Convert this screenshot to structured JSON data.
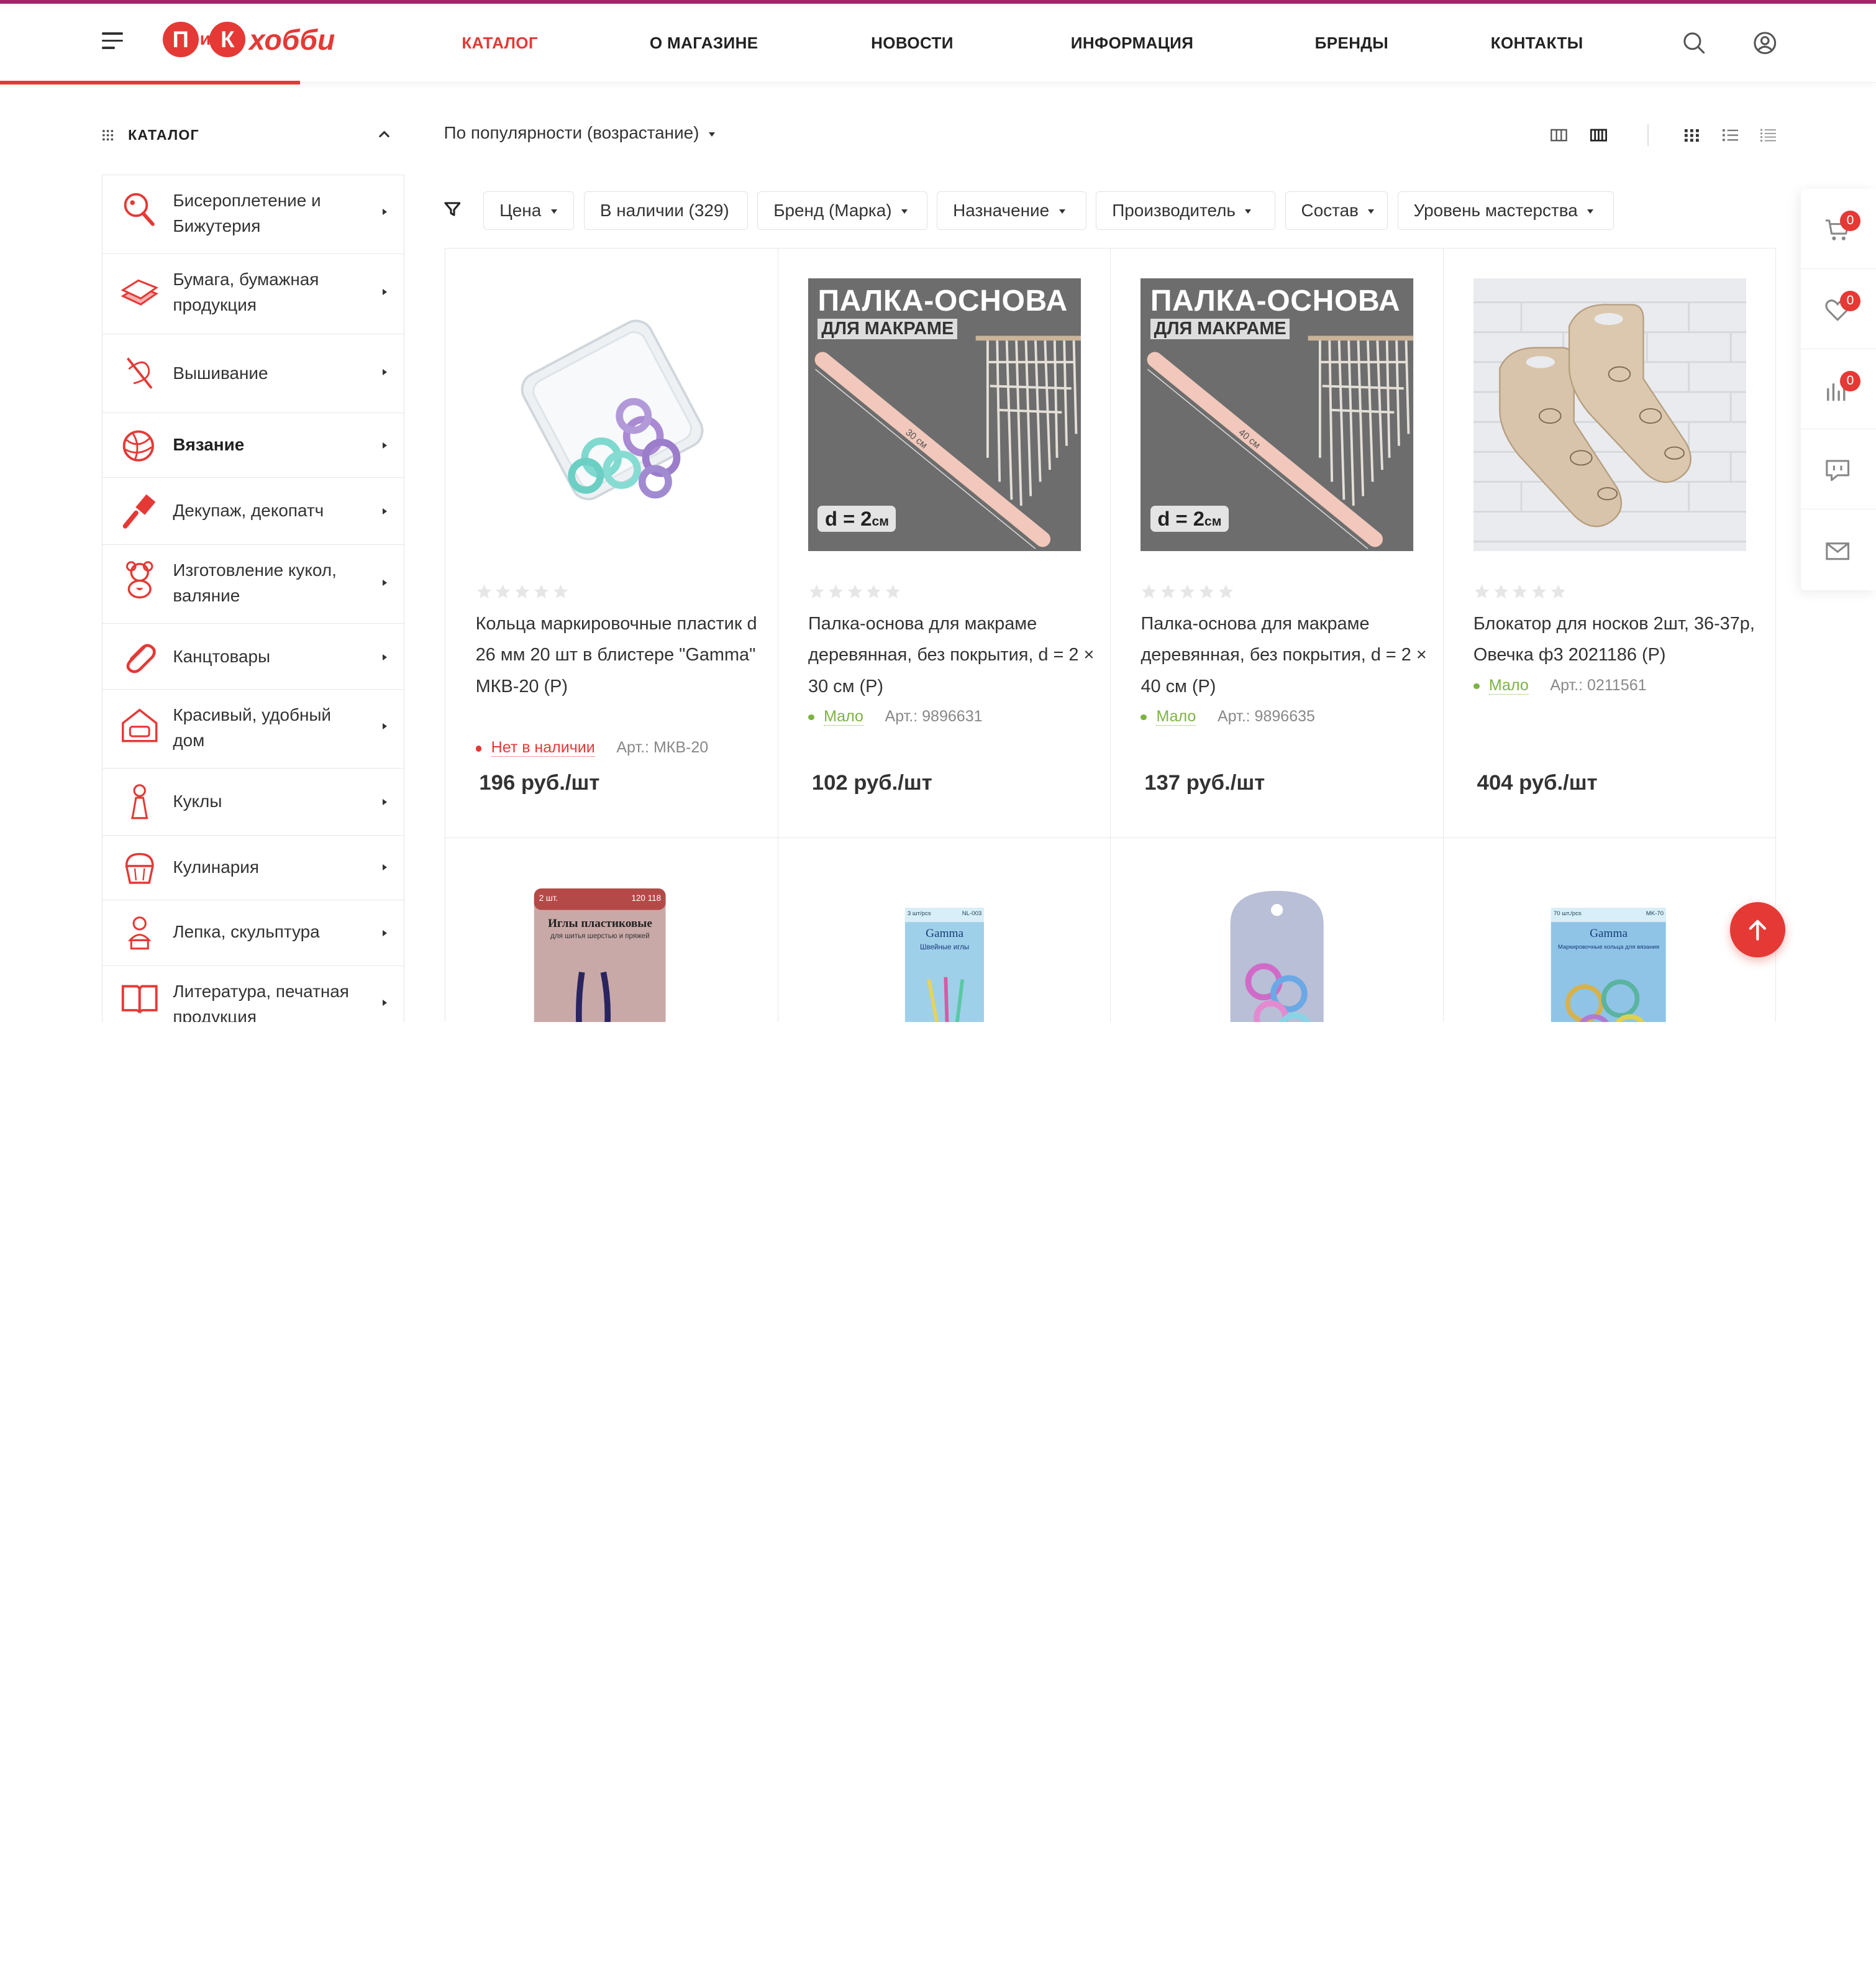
{
  "header": {
    "logo": {
      "first": "П",
      "mid": "и",
      "second": "К",
      "word": "хобби"
    },
    "nav": [
      "КАТАЛОГ",
      "О МАГАЗИНЕ",
      "НОВОСТИ",
      "ИНФОРМАЦИЯ",
      "БРЕНДЫ",
      "КОНТАКТЫ"
    ],
    "active_nav": "КАТАЛОГ"
  },
  "sidebar": {
    "title": "КАТАЛОГ",
    "items": [
      {
        "label": "Бисероплетение и Бижутерия",
        "icon": "magnifier-bead-icon"
      },
      {
        "label": "Бумага, бумажная продукция",
        "icon": "paper-stack-icon"
      },
      {
        "label": "Вышивание",
        "icon": "needle-thread-icon"
      },
      {
        "label": "Вязание",
        "icon": "yarn-ball-icon",
        "bold": true
      },
      {
        "label": "Декупаж, декопатч",
        "icon": "brush-icon"
      },
      {
        "label": "Изготовление кукол, валяние",
        "icon": "teddy-bear-icon"
      },
      {
        "label": "Канцтовары",
        "icon": "paperclip-icon"
      },
      {
        "label": "Красивый, удобный дом",
        "icon": "home-sofa-icon"
      },
      {
        "label": "Куклы",
        "icon": "doll-icon"
      },
      {
        "label": "Кулинария",
        "icon": "cupcake-icon"
      },
      {
        "label": "Лепка, скульптура",
        "icon": "bust-sculpture-icon"
      },
      {
        "label": "Литература, печатная продукция",
        "icon": "open-book-icon"
      }
    ]
  },
  "toolbar": {
    "sort_label": "По популярности (возрастание)",
    "filters": [
      "Цена",
      "В наличии (329)",
      "Бренд (Марка)",
      "Назначение",
      "Производитель",
      "Состав",
      "Уровень мастерства"
    ]
  },
  "products": [
    {
      "title": "Кольца маркировочные пластик d 26 мм 20 шт в блистере \"Gamma\" МКВ-20 (Р)",
      "stock": "Нет в наличии",
      "stock_color": "#e53935",
      "article": "Арт.: МКВ-20",
      "price": "196 руб./шт",
      "rating": 0
    },
    {
      "title": "Палка-основа для макраме деревянная, без покрытия, d = 2 × 30 см (Р)",
      "stock": "Мало",
      "stock_color": "#7cb342",
      "article": "Арт.: 9896631",
      "price": "102 руб./шт",
      "rating": 0,
      "image_text": {
        "title": "ПАЛКА-ОСНОВА",
        "sub": "ДЛЯ МАКРАМЕ",
        "d": "d = 2",
        "unit": "см",
        "len": "30 см"
      }
    },
    {
      "title": "Палка-основа для макраме деревянная, без покрытия, d = 2 × 40 см (Р)",
      "stock": "Мало",
      "stock_color": "#7cb342",
      "article": "Арт.: 9896635",
      "price": "137 руб./шт",
      "rating": 0,
      "image_text": {
        "title": "ПАЛКА-ОСНОВА",
        "sub": "ДЛЯ МАКРАМЕ",
        "d": "d = 2",
        "unit": "см",
        "len": "40 см"
      }
    },
    {
      "title": "Блокатор для носков 2шт, 36-37р, Овечка ф3 2021186 (Р)",
      "stock": "Мало",
      "stock_color": "#7cb342",
      "article": "Арт.: 0211561",
      "price": "404 руб./шт",
      "rating": 0
    }
  ],
  "second_row_images": [
    {
      "header_left": "2 шт.",
      "header_right": "120 118",
      "title": "Иглы пластиковые",
      "sub": "для шитья шерстью и пряжей"
    },
    {
      "header_left": "3 шт/pcs",
      "header_right": "NL-003",
      "brand": "Gamma",
      "sub": "Швейные иглы"
    },
    {},
    {
      "header_left": "70 шт./pcs",
      "header_right": "MK-70",
      "brand": "Gamma",
      "sub": "Маркировочные кольца для вязания"
    }
  ],
  "floating": {
    "cart_count": "0",
    "favorites_count": "0",
    "compare_count": "0"
  },
  "colors": {
    "accent": "#e53935",
    "topline": "#a0286a",
    "in_stock_low": "#7cb342"
  }
}
